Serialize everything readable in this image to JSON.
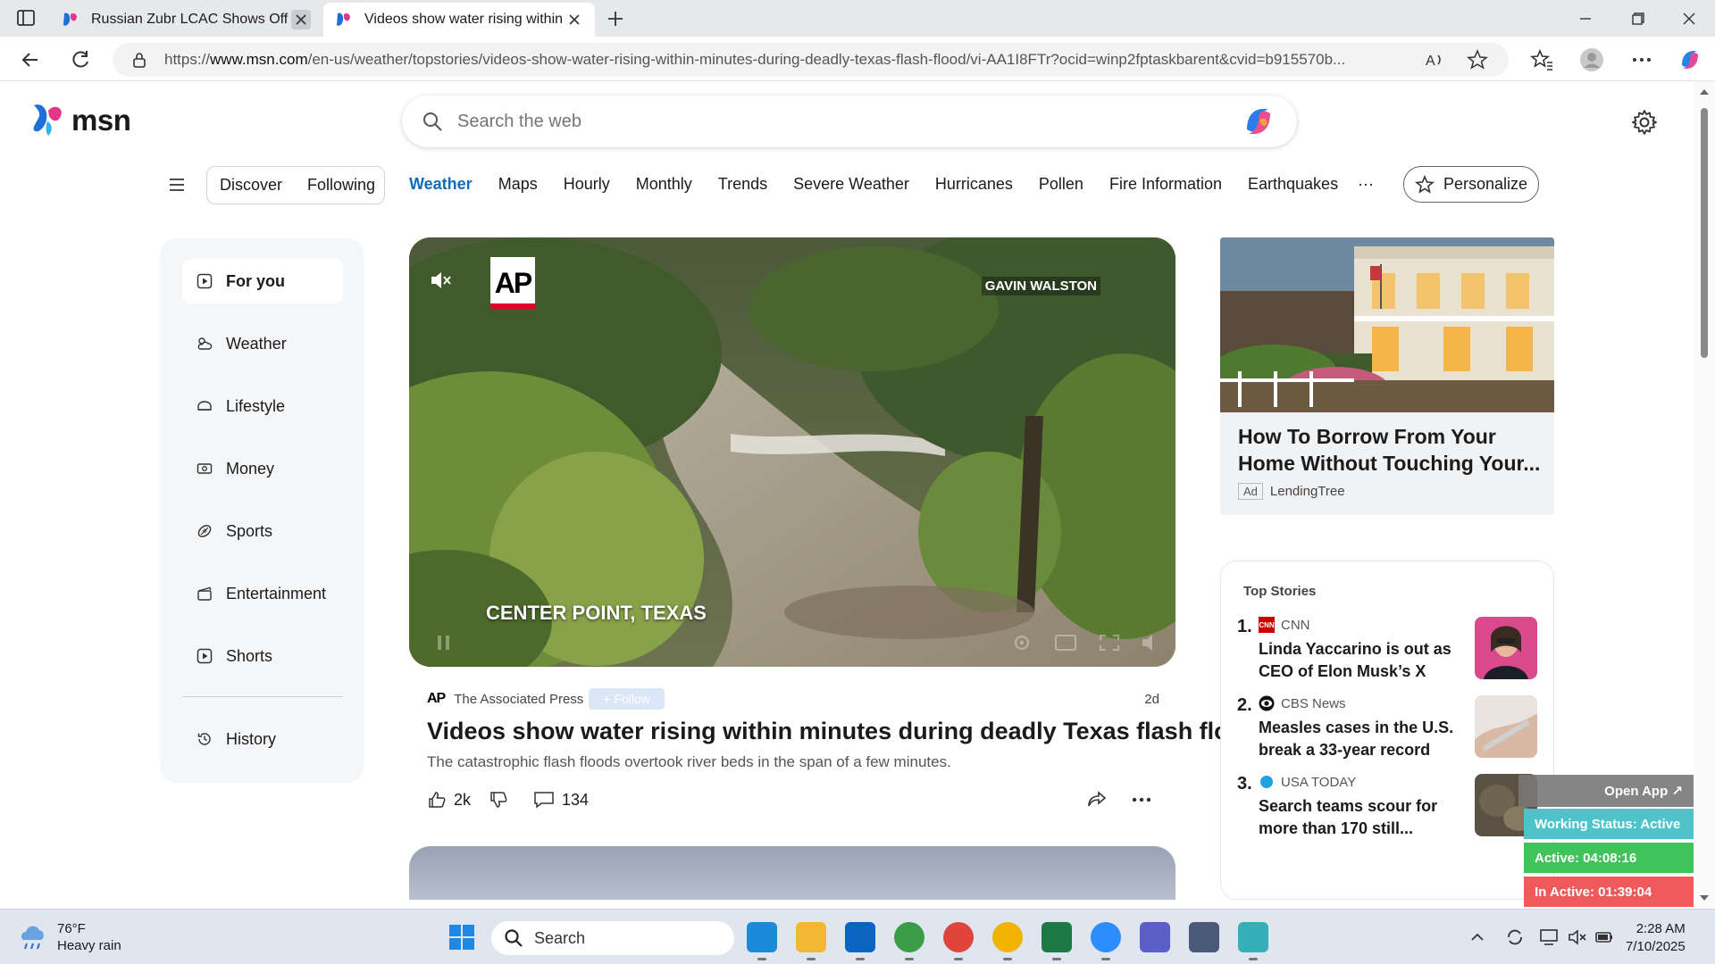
{
  "browser": {
    "tabs": [
      {
        "title": "Russian Zubr LCAC Shows Off Its",
        "active": false
      },
      {
        "title": "Videos show water rising within m",
        "active": true
      }
    ],
    "url_prefix": "https://",
    "url_host": "www.msn.com",
    "url_path": "/en-us/weather/topstories/videos-show-water-rising-within-minutes-during-deadly-texas-flash-flood/vi-AA1I8FTr?ocid=winp2fptaskbarent&cvid=b915570b..."
  },
  "msn": {
    "logo_text": "msn",
    "search_placeholder": "Search the web"
  },
  "nav": {
    "pill": [
      "Discover",
      "Following"
    ],
    "links": [
      "Weather",
      "Maps",
      "Hourly",
      "Monthly",
      "Trends",
      "Severe Weather",
      "Hurricanes",
      "Pollen",
      "Fire Information",
      "Earthquakes"
    ],
    "active": "Weather",
    "more": "···",
    "personalize": "Personalize"
  },
  "sidebar": {
    "items": [
      {
        "label": "For you",
        "icon": "play-square-icon"
      },
      {
        "label": "Weather",
        "icon": "weather-icon"
      },
      {
        "label": "Lifestyle",
        "icon": "lifestyle-icon"
      },
      {
        "label": "Money",
        "icon": "money-icon"
      },
      {
        "label": "Sports",
        "icon": "sports-icon"
      },
      {
        "label": "Entertainment",
        "icon": "entertainment-icon"
      },
      {
        "label": "Shorts",
        "icon": "shorts-icon"
      }
    ],
    "history": "History"
  },
  "video": {
    "ap_logo": "AP",
    "byline": "GAVIN WALSTON",
    "location": "CENTER POINT, TEXAS"
  },
  "article": {
    "source_logo": "AP",
    "source": "The Associated Press",
    "follow": "Follow",
    "age": "2d",
    "headline": "Videos show water rising within minutes during deadly Texas flash flood",
    "summary": "The catastrophic flash floods overtook river beds in the span of a few minutes.",
    "likes": "2k",
    "comments": "134"
  },
  "ad": {
    "title": "How To Borrow From Your Home Without Touching Your...",
    "badge": "Ad",
    "source": "LendingTree"
  },
  "top_stories": {
    "heading": "Top Stories",
    "items": [
      {
        "num": "1.",
        "source": "CNN",
        "logo_text": "CNN",
        "title": "Linda Yaccarino is out as CEO of Elon Musk’s X"
      },
      {
        "num": "2.",
        "source": "CBS News",
        "logo_text": "",
        "title": "Measles cases in the U.S. break a 33-year record"
      },
      {
        "num": "3.",
        "source": "USA TODAY",
        "logo_text": "",
        "title": "Search teams scour for more than 170 still..."
      }
    ]
  },
  "overlay": {
    "open_app": "Open App ↗",
    "working_status": "Working Status: Active",
    "active": "Active: 04:08:16",
    "inactive": "In Active: 01:39:04",
    "colors": {
      "status": "#4fc3c9",
      "active": "#3fc35a",
      "inactive": "#f05a5a"
    }
  },
  "taskbar": {
    "temp": "76°F",
    "condition": "Heavy rain",
    "search": "Search",
    "time": "2:28 AM",
    "date": "7/10/2025"
  }
}
